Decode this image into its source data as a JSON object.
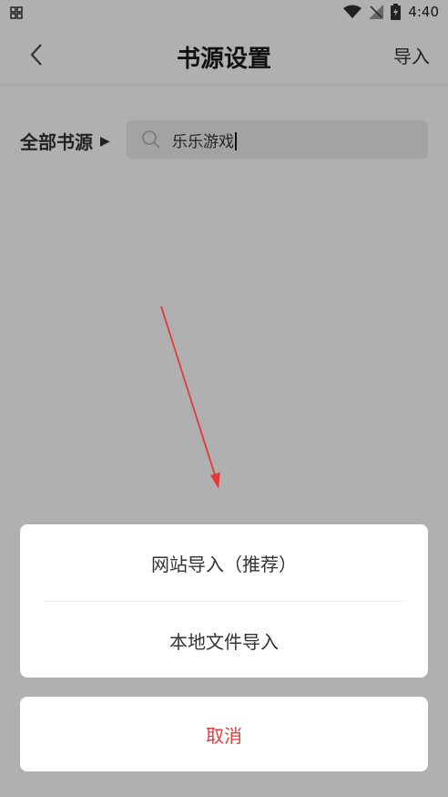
{
  "status_bar": {
    "time": "4:40"
  },
  "header": {
    "title": "书源设置",
    "import_label": "导入"
  },
  "filter": {
    "category_label": "全部书源",
    "search_value": "乐乐游戏"
  },
  "sheet": {
    "options": [
      {
        "label": "网站导入（推荐）"
      },
      {
        "label": "本地文件导入"
      }
    ],
    "cancel_label": "取消"
  },
  "colors": {
    "overlay_bg": "#b0b0b0",
    "cancel_text": "#e03b3b",
    "annotation_arrow": "#e53935"
  }
}
